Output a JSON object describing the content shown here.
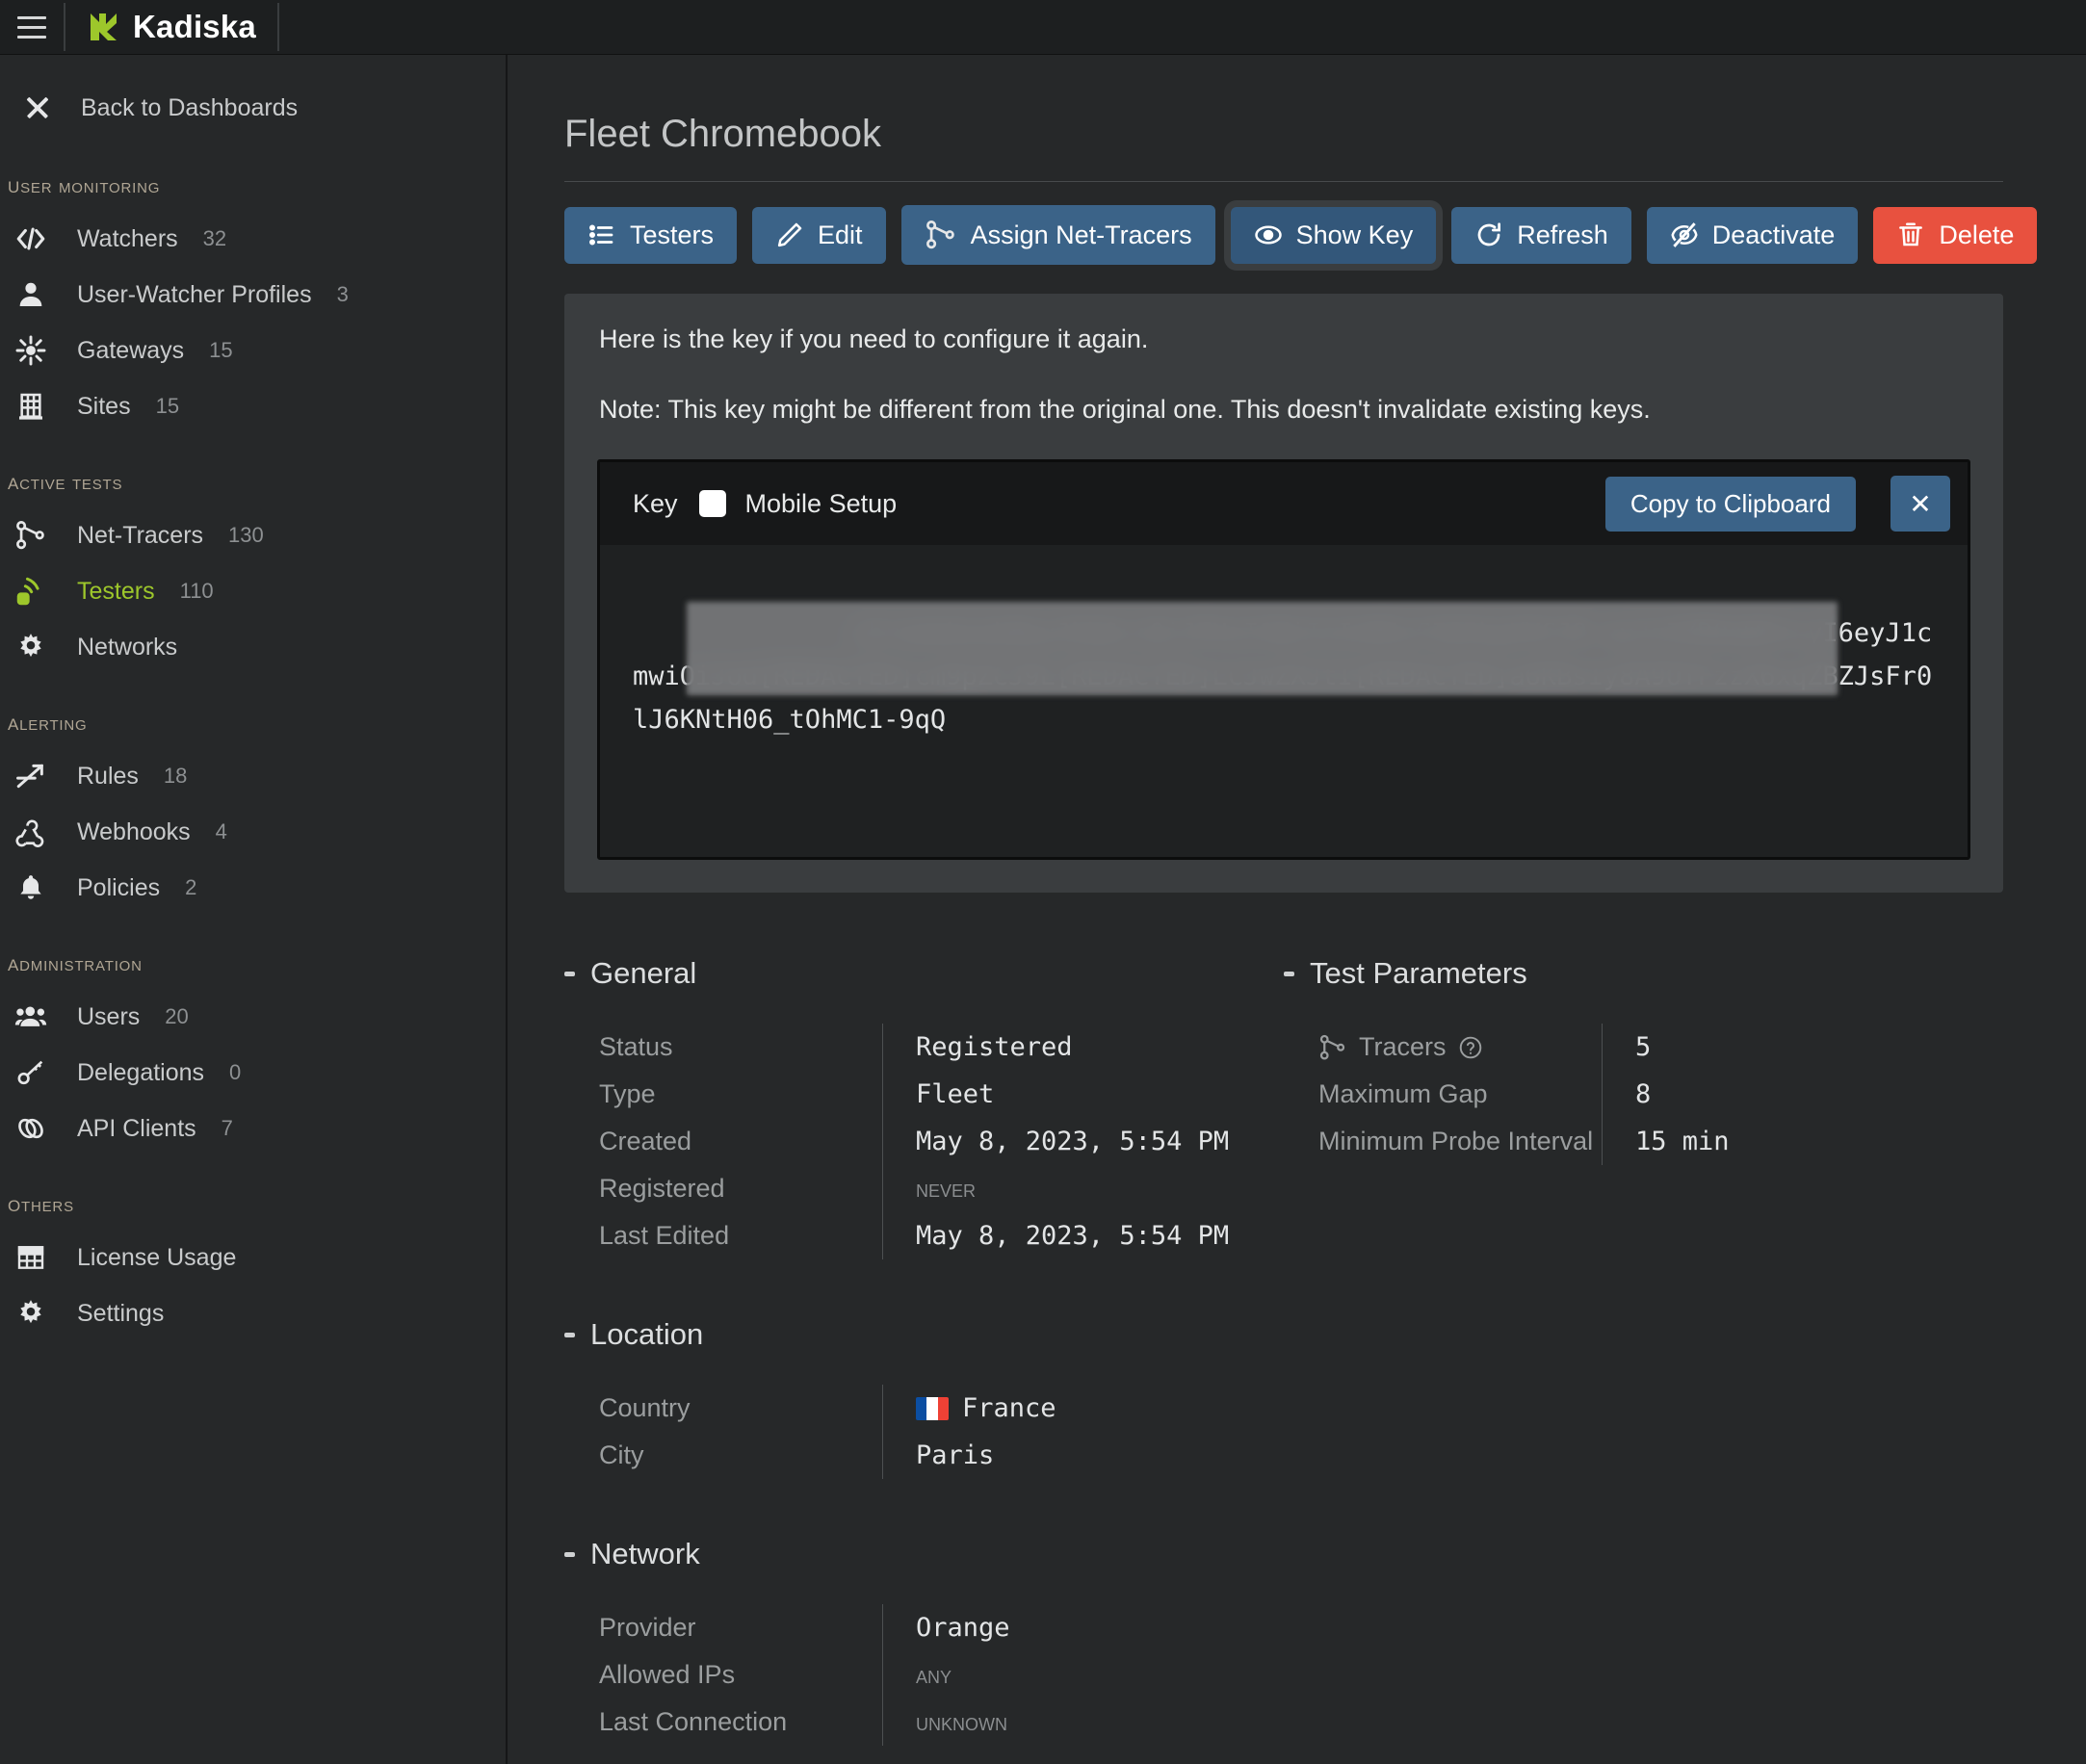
{
  "topbar": {
    "menu_icon": "hamburger-icon",
    "brand": "Kadiska"
  },
  "sidebar": {
    "back": {
      "label": "Back to Dashboards",
      "icon": "close-icon"
    },
    "sections": [
      {
        "title": "User Monitoring",
        "items": [
          {
            "label": "Watchers",
            "count": "32",
            "icon": "code-icon",
            "active": false
          },
          {
            "label": "User-Watcher Profiles",
            "count": "3",
            "icon": "user-icon",
            "active": false
          },
          {
            "label": "Gateways",
            "count": "15",
            "icon": "hub-icon",
            "active": false
          },
          {
            "label": "Sites",
            "count": "15",
            "icon": "building-icon",
            "active": false
          }
        ]
      },
      {
        "title": "Active Tests",
        "items": [
          {
            "label": "Net-Tracers",
            "count": "130",
            "icon": "network-node-icon",
            "active": false
          },
          {
            "label": "Testers",
            "count": "110",
            "icon": "broadcast-icon",
            "active": true
          },
          {
            "label": "Networks",
            "count": "",
            "icon": "gear-icon",
            "active": false
          }
        ]
      },
      {
        "title": "Alerting",
        "items": [
          {
            "label": "Rules",
            "count": "18",
            "icon": "trend-arrow-icon",
            "active": false
          },
          {
            "label": "Webhooks",
            "count": "4",
            "icon": "webhook-icon",
            "active": false
          },
          {
            "label": "Policies",
            "count": "2",
            "icon": "bell-icon",
            "active": false
          }
        ]
      },
      {
        "title": "Administration",
        "items": [
          {
            "label": "Users",
            "count": "20",
            "icon": "users-icon",
            "active": false
          },
          {
            "label": "Delegations",
            "count": "0",
            "icon": "key-icon",
            "active": false
          },
          {
            "label": "API Clients",
            "count": "7",
            "icon": "link-icon",
            "active": false
          }
        ]
      },
      {
        "title": "Others",
        "items": [
          {
            "label": "License Usage",
            "count": "",
            "icon": "grid-icon",
            "active": false
          },
          {
            "label": "Settings",
            "count": "",
            "icon": "gear-icon",
            "active": false
          }
        ]
      }
    ]
  },
  "page": {
    "title": "Fleet Chromebook"
  },
  "toolbar": {
    "buttons": [
      {
        "label": "Testers",
        "icon": "list-icon",
        "style": "primary"
      },
      {
        "label": "Edit",
        "icon": "pencil-icon",
        "style": "primary"
      },
      {
        "label": "Assign Net-Tracers",
        "icon": "network-node-icon",
        "style": "primary"
      },
      {
        "label": "Show Key",
        "icon": "eye-icon",
        "style": "primary-pressed"
      },
      {
        "label": "Refresh",
        "icon": "refresh-icon",
        "style": "primary"
      },
      {
        "label": "Deactivate",
        "icon": "eye-off-icon",
        "style": "primary"
      },
      {
        "label": "Delete",
        "icon": "trash-icon",
        "style": "danger"
      }
    ]
  },
  "key_panel": {
    "message": "Here is the key if you need to configure it again.",
    "note": "Note: This key might be different from the original one. This doesn't invalidate existing keys.",
    "header_label": "Key",
    "mobile_setup_label": "Mobile Setup",
    "mobile_setup_checked": false,
    "copy_label": "Copy to Clipboard",
    "close_label": "✕",
    "key_value": "chromebook#eyJhbGciOiJFUzI1NiIsInR5cCI6IkpXVCJ9.eyJzZXR0aW5ncyI6eyJ1cmwiOiJod[REDACTED]cm9pZCJ9L[REDACTED]LCJwZXJtI[REDACTED]a6KBsIy8A9OTFzzX6xqZBZJsFr0lJ6KNtH06_tOhMC1-9qQ"
  },
  "details": {
    "general": {
      "title": "General",
      "rows": [
        {
          "label": "Status",
          "value": "Registered",
          "muted": false
        },
        {
          "label": "Type",
          "value": "Fleet",
          "muted": false
        },
        {
          "label": "Created",
          "value": "May 8, 2023, 5:54 PM",
          "muted": false
        },
        {
          "label": "Registered",
          "value": "Never",
          "muted": true
        },
        {
          "label": "Last Edited",
          "value": "May 8, 2023, 5:54 PM",
          "muted": false
        }
      ]
    },
    "test_parameters": {
      "title": "Test Parameters",
      "rows": [
        {
          "label": "Tracers",
          "value": "5",
          "muted": false,
          "icon": "network-node-icon",
          "help": true
        },
        {
          "label": "Maximum Gap",
          "value": "8",
          "muted": false
        },
        {
          "label": "Minimum Probe Interval",
          "value": "15 min",
          "muted": false
        }
      ]
    },
    "location": {
      "title": "Location",
      "rows": [
        {
          "label": "Country",
          "value": "France",
          "muted": false,
          "flag": "fr"
        },
        {
          "label": "City",
          "value": "Paris",
          "muted": false
        }
      ]
    },
    "network": {
      "title": "Network",
      "rows": [
        {
          "label": "Provider",
          "value": "Orange",
          "muted": false
        },
        {
          "label": "Allowed IPs",
          "value": "Any",
          "muted": true
        },
        {
          "label": "Last Connection",
          "value": "Unknown",
          "muted": true
        }
      ]
    }
  },
  "colors": {
    "accent_green": "#9dc72b",
    "primary_button": "#3b6388",
    "danger_button": "#e8513f",
    "panel_bg": "#3a3d3f",
    "app_bg": "#262829"
  }
}
